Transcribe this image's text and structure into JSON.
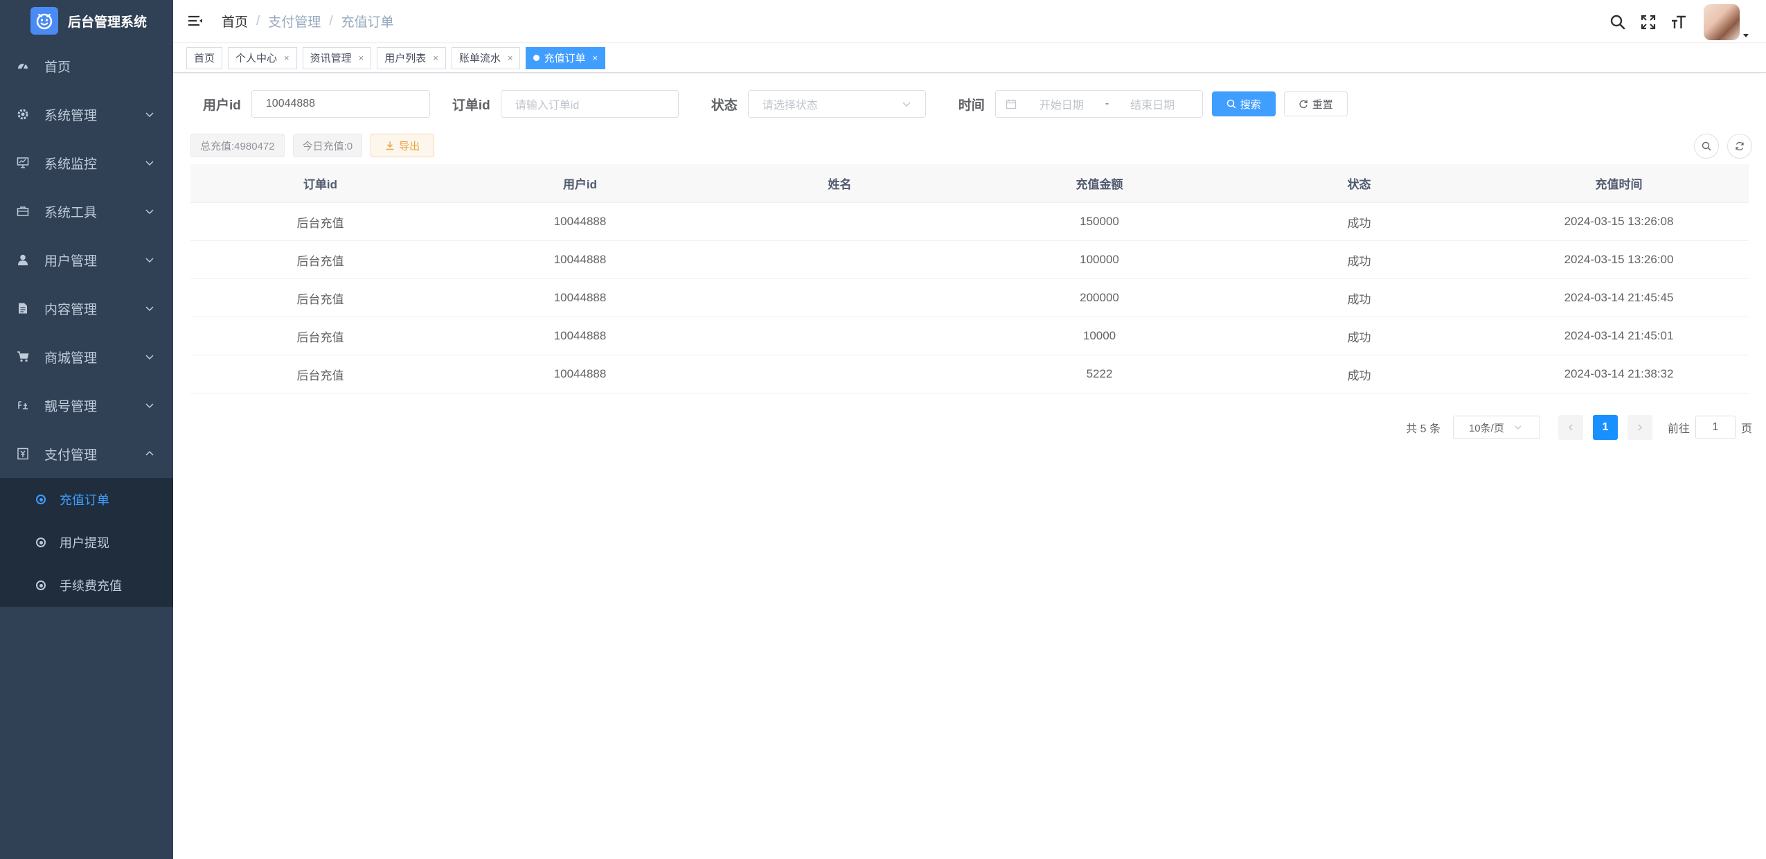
{
  "app": {
    "title": "后台管理系统"
  },
  "sidebar": {
    "items": [
      {
        "label": "首页",
        "icon": "dashboard-icon"
      },
      {
        "label": "系统管理",
        "icon": "gear-icon"
      },
      {
        "label": "系统监控",
        "icon": "monitor-icon"
      },
      {
        "label": "系统工具",
        "icon": "toolbox-icon"
      },
      {
        "label": "用户管理",
        "icon": "user-icon"
      },
      {
        "label": "内容管理",
        "icon": "document-icon"
      },
      {
        "label": "商城管理",
        "icon": "cart-icon"
      },
      {
        "label": "靓号管理",
        "icon": "number-icon"
      },
      {
        "label": "支付管理",
        "icon": "yuan-icon"
      }
    ],
    "payment_submenu": [
      {
        "label": "充值订单",
        "active": true
      },
      {
        "label": "用户提现",
        "active": false
      },
      {
        "label": "手续费充值",
        "active": false
      }
    ]
  },
  "breadcrumb": [
    "首页",
    "支付管理",
    "充值订单"
  ],
  "tags": [
    {
      "label": "首页",
      "closable": false,
      "active": false
    },
    {
      "label": "个人中心",
      "closable": true,
      "active": false
    },
    {
      "label": "资讯管理",
      "closable": true,
      "active": false
    },
    {
      "label": "用户列表",
      "closable": true,
      "active": false
    },
    {
      "label": "账单流水",
      "closable": true,
      "active": false
    },
    {
      "label": "充值订单",
      "closable": true,
      "active": true
    }
  ],
  "search": {
    "user_id_label": "用户id",
    "user_id_value": "10044888",
    "order_id_label": "订单id",
    "order_id_placeholder": "请输入订单id",
    "status_label": "状态",
    "status_placeholder": "请选择状态",
    "time_label": "时间",
    "start_placeholder": "开始日期",
    "range_sep": "-",
    "end_placeholder": "结束日期",
    "search_btn": "搜索",
    "reset_btn": "重置"
  },
  "toolbar": {
    "total_recharge": "总充值:4980472",
    "today_recharge": "今日充值:0",
    "export_btn": "导出"
  },
  "table": {
    "columns": [
      "订单id",
      "用户id",
      "姓名",
      "充值金额",
      "状态",
      "充值时间"
    ],
    "rows": [
      [
        "后台充值",
        "10044888",
        "",
        "150000",
        "成功",
        "2024-03-15 13:26:08"
      ],
      [
        "后台充值",
        "10044888",
        "",
        "100000",
        "成功",
        "2024-03-15 13:26:00"
      ],
      [
        "后台充值",
        "10044888",
        "",
        "200000",
        "成功",
        "2024-03-14 21:45:45"
      ],
      [
        "后台充值",
        "10044888",
        "",
        "10000",
        "成功",
        "2024-03-14 21:45:01"
      ],
      [
        "后台充值",
        "10044888",
        "",
        "5222",
        "成功",
        "2024-03-14 21:38:32"
      ]
    ]
  },
  "pagination": {
    "total": "共 5 条",
    "page_size": "10条/页",
    "current": "1",
    "goto_label": "前往",
    "goto_value": "1",
    "page_suffix": "页"
  },
  "colors": {
    "sidebar_bg": "#304156",
    "submenu_bg": "#1f2d3d",
    "primary": "#409eff",
    "warning": "#e6a23c"
  }
}
